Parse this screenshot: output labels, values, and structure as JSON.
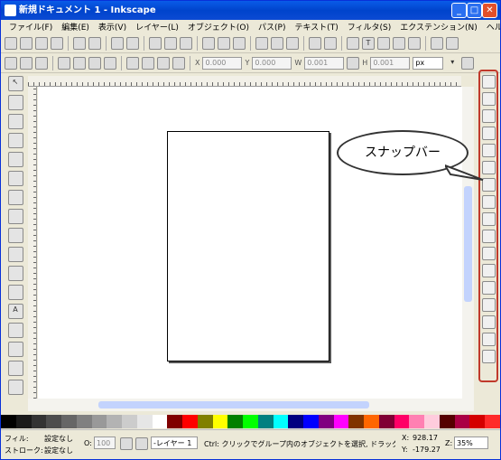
{
  "title": "新規ドキュメント 1 - Inkscape",
  "menu": [
    "ファイル(F)",
    "編集(E)",
    "表示(V)",
    "レイヤー(L)",
    "オブジェクト(O)",
    "パス(P)",
    "テキスト(T)",
    "フィルタ(S)",
    "エクステンション(N)",
    "ヘルプ(H)"
  ],
  "tool_controls": {
    "x_label": "X",
    "x_value": "0.000",
    "y_label": "Y",
    "y_value": "0.000",
    "w_label": "W",
    "w_value": "0.001",
    "h_label": "H",
    "h_value": "0.001",
    "unit": "px"
  },
  "callout": "スナップバー",
  "status": {
    "fill_label": "フィル:",
    "fill_value": "設定なし",
    "stroke_label": "ストローク:",
    "stroke_value": "設定なし",
    "opacity_label": "O:",
    "opacity_value": "100",
    "layer": "-レイヤー 1",
    "message": "Ctrl: クリックでグループ内のオブジェクトを選択, ドラッグで水平/...",
    "x_label": "X:",
    "x_value": "928.17",
    "y_label": "Y:",
    "y_value": "-179.27",
    "zoom_label": "Z:",
    "zoom_value": "35%"
  },
  "palette": [
    "#000000",
    "#1a1a1a",
    "#333333",
    "#4d4d4d",
    "#666666",
    "#808080",
    "#999999",
    "#b3b3b3",
    "#cccccc",
    "#e6e6e6",
    "#ffffff",
    "#800000",
    "#ff0000",
    "#808000",
    "#ffff00",
    "#008000",
    "#00ff00",
    "#008080",
    "#00ffff",
    "#000080",
    "#0000ff",
    "#800080",
    "#ff00ff",
    "#803300",
    "#ff6600",
    "#800033",
    "#ff0066",
    "#ff80b2",
    "#ffccdd",
    "#550000",
    "#aa0044",
    "#d40000",
    "#ff2a2a"
  ]
}
